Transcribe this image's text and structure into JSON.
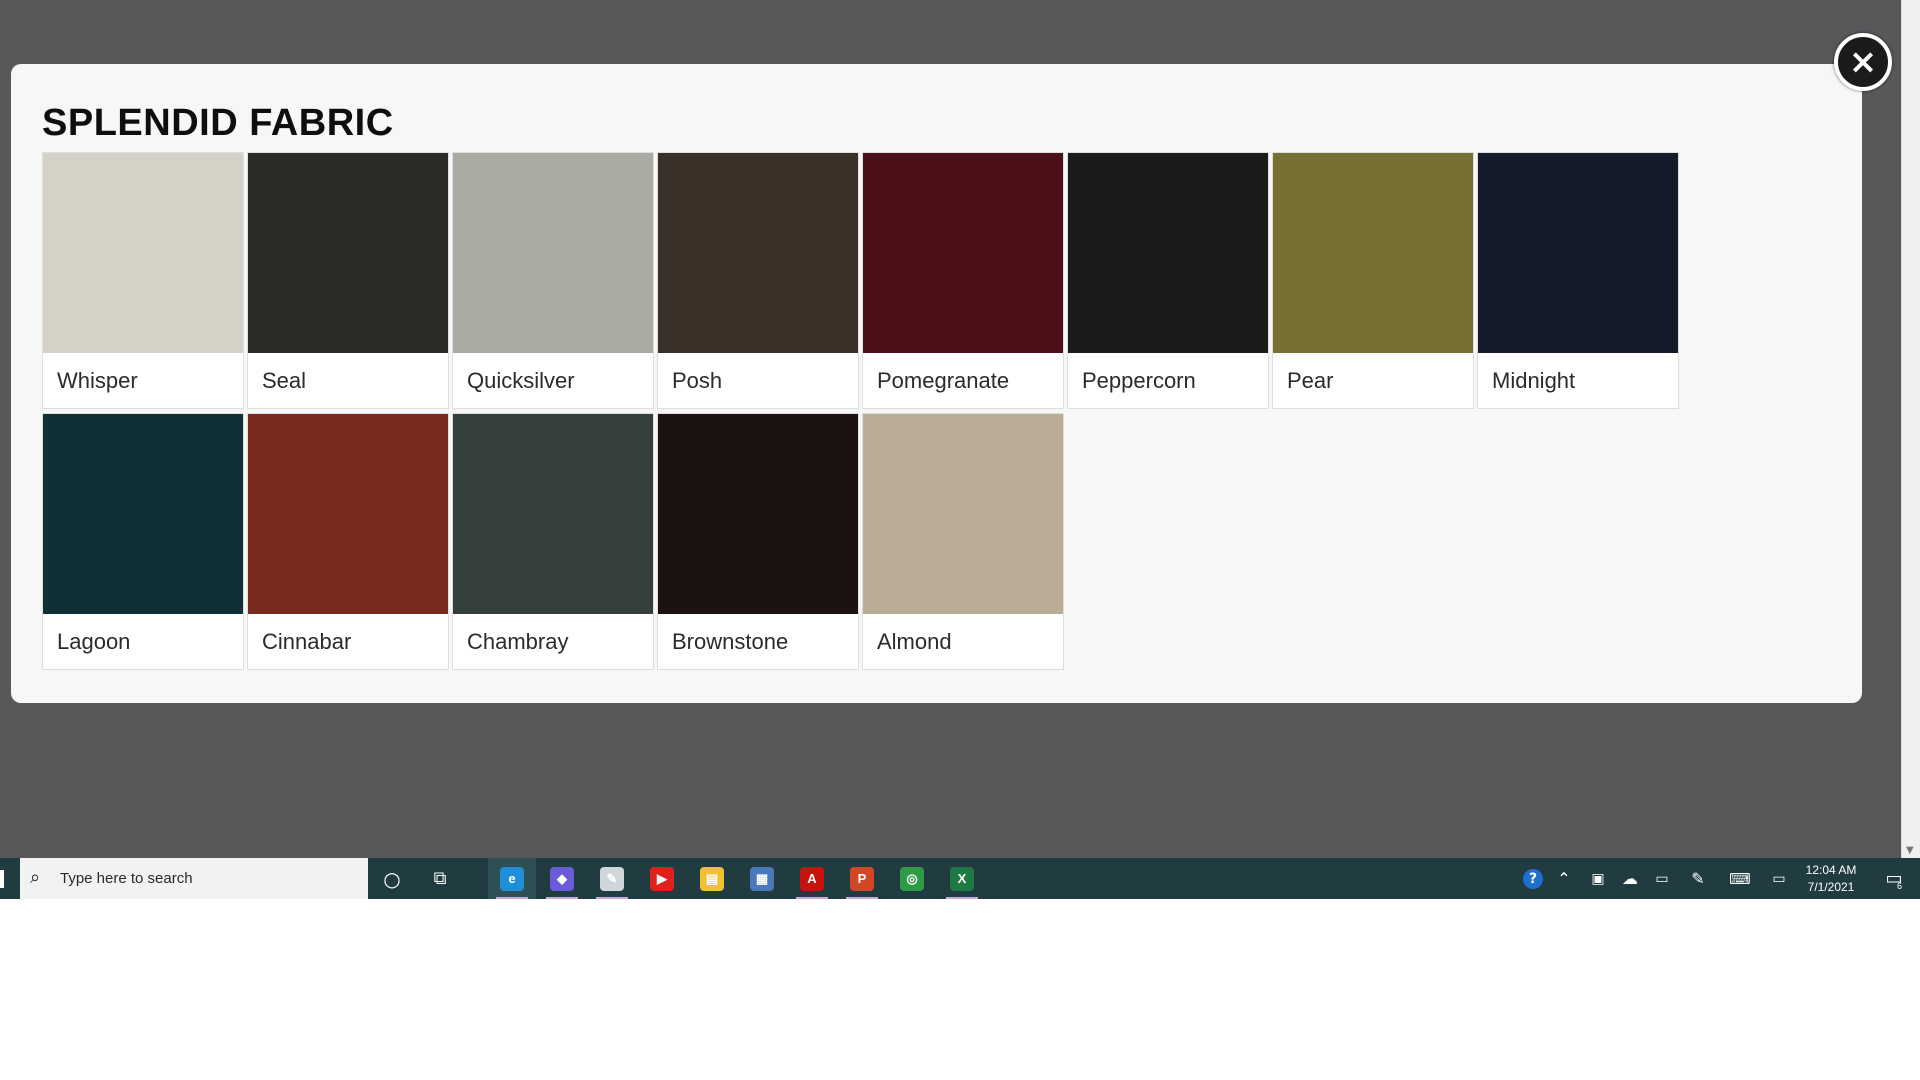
{
  "modal": {
    "title": "SPLENDID FABRIC",
    "close_label": "×",
    "fabrics": [
      {
        "name": "Whisper",
        "color": "#d6d1c6"
      },
      {
        "name": "Seal",
        "color": "#2b2b27"
      },
      {
        "name": "Quicksilver",
        "color": "#a9aba3"
      },
      {
        "name": "Posh",
        "color": "#3b3128"
      },
      {
        "name": "Pomegranate",
        "color": "#4d0f18"
      },
      {
        "name": "Peppercorn",
        "color": "#1b1b1b"
      },
      {
        "name": "Pear",
        "color": "#777033"
      },
      {
        "name": "Midnight",
        "color": "#141b2b"
      },
      {
        "name": "Lagoon",
        "color": "#0f3035"
      },
      {
        "name": "Cinnabar",
        "color": "#782a1c"
      },
      {
        "name": "Chambray",
        "color": "#35403d"
      },
      {
        "name": "Brownstone",
        "color": "#1c1210"
      },
      {
        "name": "Almond",
        "color": "#b9ad97"
      }
    ]
  },
  "taskbar": {
    "search_placeholder": "Type here to search",
    "apps": [
      {
        "icon": "edge-icon",
        "color": "#1f8fd8",
        "glyph": "e",
        "active": true
      },
      {
        "icon": "droplet-app-icon",
        "color": "#6a5bd8",
        "glyph": "◆",
        "active": false
      },
      {
        "icon": "paint-app-icon",
        "color": "#cfd6dc",
        "glyph": "✎",
        "active": false
      },
      {
        "icon": "youtube-icon",
        "color": "#e0201b",
        "glyph": "▶",
        "active": false
      },
      {
        "icon": "file-explorer-icon",
        "color": "#f0c232",
        "glyph": "▤",
        "active": false
      },
      {
        "icon": "calculator-icon",
        "color": "#4a78b8",
        "glyph": "▦",
        "active": false
      },
      {
        "icon": "acrobat-icon",
        "color": "#c8120f",
        "glyph": "A",
        "active": false
      },
      {
        "icon": "powerpoint-icon",
        "color": "#d24726",
        "glyph": "P",
        "active": false
      },
      {
        "icon": "chrome-icon",
        "color": "#2f9a45",
        "glyph": "◎",
        "active": false
      },
      {
        "icon": "excel-icon",
        "color": "#1d7a43",
        "glyph": "X",
        "active": false
      }
    ],
    "clock": {
      "time": "12:04 AM",
      "date": "7/1/2021"
    },
    "notification_count": "6"
  }
}
